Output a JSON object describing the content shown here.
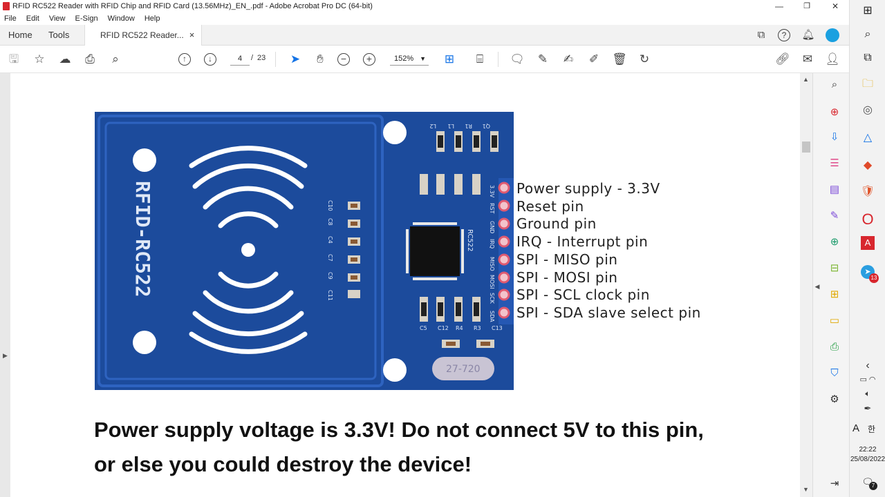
{
  "window": {
    "title": "RFID RC522 Reader with RFID Chip and RFID Card (13.56MHz)_EN_.pdf - Adobe Acrobat Pro DC (64-bit)",
    "minimize": "—",
    "maximize": "❐",
    "close": "✕"
  },
  "menu": [
    "File",
    "Edit",
    "View",
    "E-Sign",
    "Window",
    "Help"
  ],
  "tabs": {
    "home": "Home",
    "tools": "Tools",
    "doc": "RFID RC522 Reader...",
    "close": "×"
  },
  "toolbar": {
    "page_current": "4",
    "page_sep": "/",
    "page_total": "23",
    "zoom": "152%"
  },
  "pcb": {
    "label": "RFID-RC522",
    "chip_label": "RC522",
    "pin_labels": [
      "3.3V",
      "RST",
      "GND",
      "IRQ",
      "MISO",
      "MOSI",
      "SCK",
      "SDA"
    ],
    "cap_labels": [
      "C10",
      "C8",
      "C4",
      "C7",
      "C9",
      "C11"
    ],
    "top_labels": [
      "L2",
      "L1",
      "R1",
      "Q1"
    ],
    "bottom_labels": [
      "C5",
      "C12",
      "R4",
      "R3",
      "C13"
    ],
    "side_label": "27-720"
  },
  "pins": [
    "Power supply - 3.3V",
    "Reset pin",
    "Ground pin",
    "IRQ - Interrupt pin",
    "SPI - MISO pin",
    "SPI - MOSI pin",
    "SPI - SCL clock pin",
    "SPI - SDA slave select pin"
  ],
  "warning": {
    "line1": "Power supply voltage is 3.3V! Do not connect 5V to this pin,",
    "line2": "or else you could destroy the device!"
  },
  "taskbar": {
    "time": "22:22",
    "date": "25/08/2022",
    "lang": "A",
    "ime": "한",
    "badge": "13",
    "notif": "7"
  },
  "colors": {
    "pcb": "#1c4b9c",
    "accent_red": "#d8272e",
    "link_blue": "#1473e6"
  }
}
